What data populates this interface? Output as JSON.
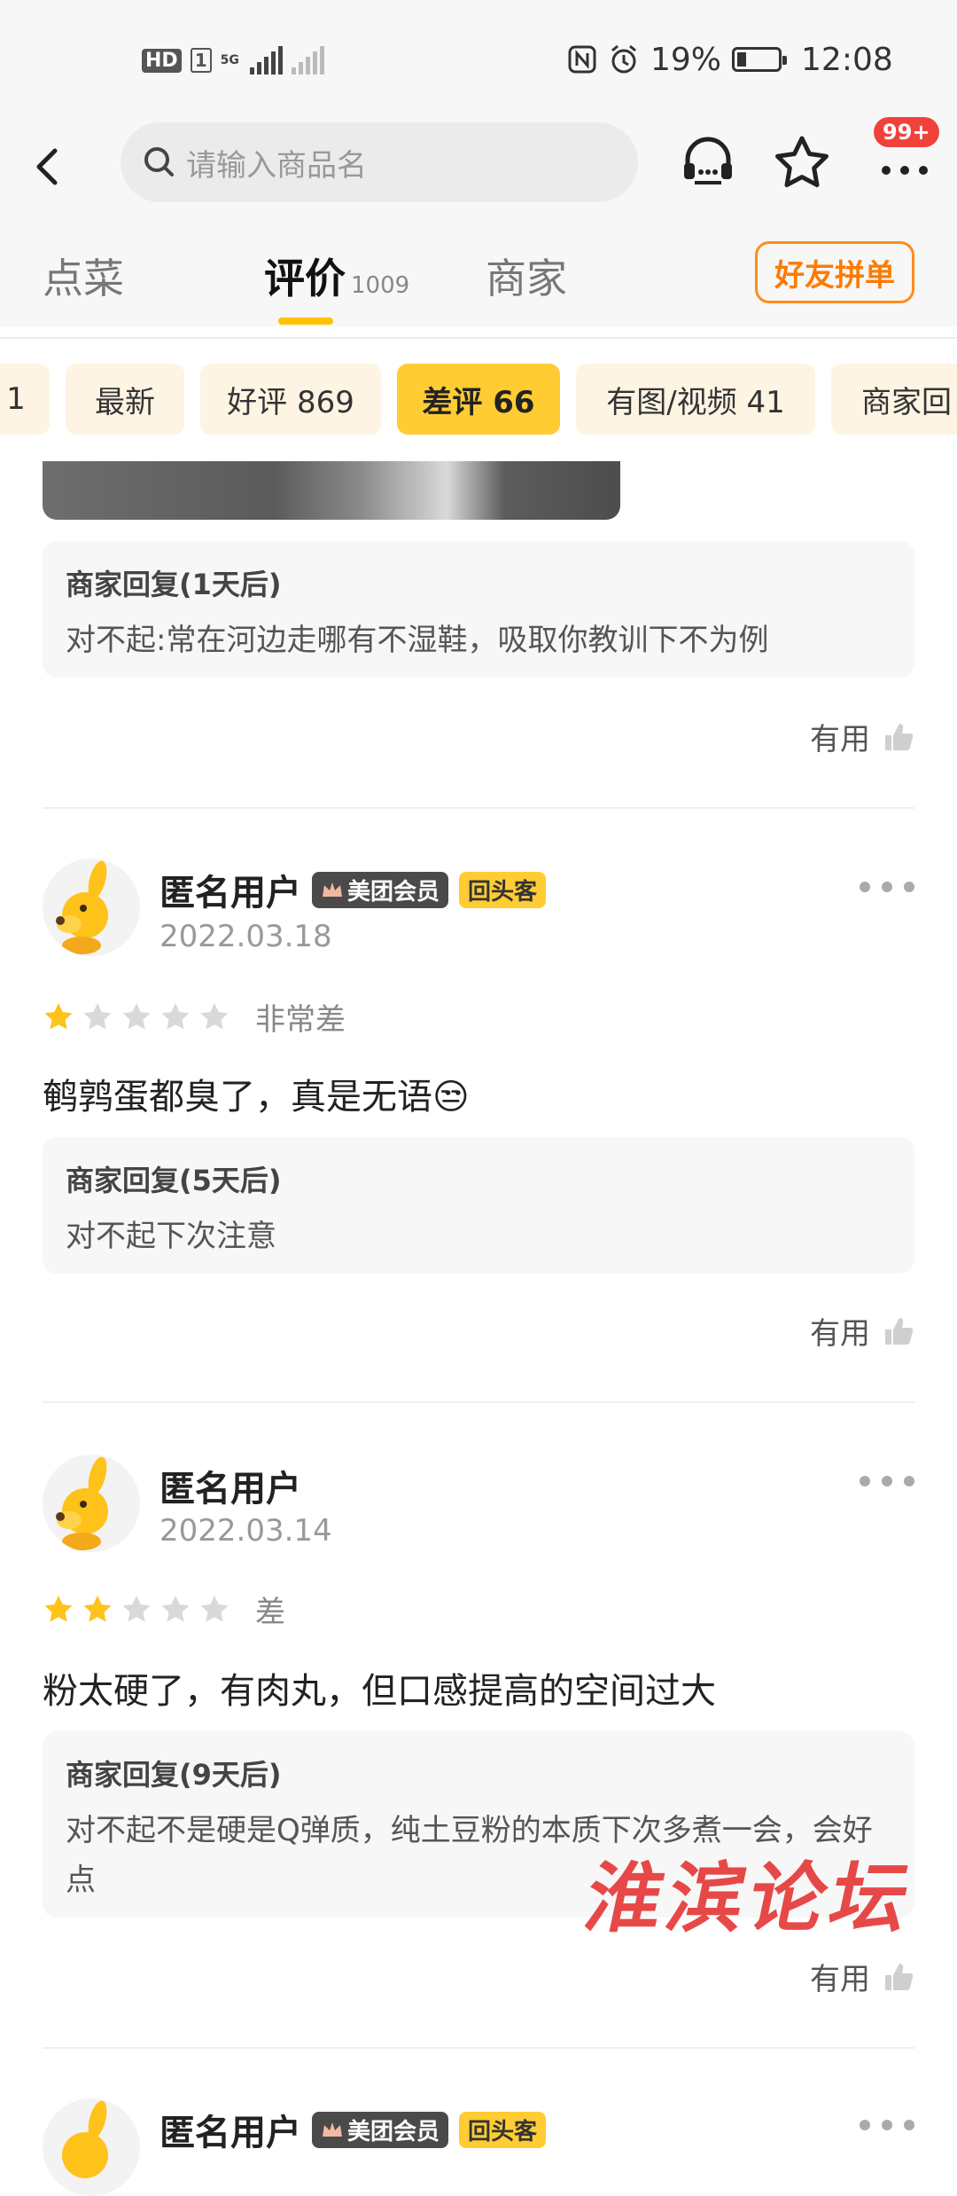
{
  "status_bar": {
    "hd": "HD",
    "sim1": "1",
    "net5g": "5G",
    "battery": "19%",
    "battery_level": 0.19,
    "time": "12:08"
  },
  "header": {
    "search_placeholder": "请输入商品名",
    "badge": "99+",
    "icons": [
      "back-icon",
      "customer-service-icon",
      "star-icon",
      "more-icon"
    ]
  },
  "tabs": [
    {
      "label": "点菜"
    },
    {
      "label": "评价",
      "count": "1009"
    },
    {
      "label": "商家"
    }
  ],
  "friend_order_button": "好友拼单",
  "filters": [
    {
      "label": "1"
    },
    {
      "label": "最新"
    },
    {
      "label": "好评 869"
    },
    {
      "label": "差评 66",
      "active": true
    },
    {
      "label": "有图/视频 41"
    },
    {
      "label": "商家回"
    }
  ],
  "reviews": [
    {
      "reply_title": "商家回复(1天后)",
      "reply_text": "对不起:常在河边走哪有不湿鞋，吸取你教训下不为例",
      "useful": "有用"
    },
    {
      "user": "匿名用户",
      "vip_badge": "美团会员",
      "repeat_badge": "回头客",
      "date": "2022.03.18",
      "stars": 1,
      "rating_text": "非常差",
      "text": "鹌鹑蛋都臭了，真是无语😒",
      "reply_title": "商家回复(5天后)",
      "reply_text": "对不起下次注意",
      "useful": "有用"
    },
    {
      "user": "匿名用户",
      "date": "2022.03.14",
      "stars": 2,
      "rating_text": "差",
      "text": "粉太硬了，有肉丸，但口感提高的空间过大",
      "reply_title": "商家回复(9天后)",
      "reply_text": "对不起不是硬是Q弹质，纯土豆粉的本质下次多煮一会，会好点",
      "useful": "有用"
    },
    {
      "user": "匿名用户",
      "vip_badge": "美团会员",
      "repeat_badge": "回头客"
    }
  ],
  "watermark": "淮滨论坛",
  "colors": {
    "accent": "#ffcc33",
    "star_on": "#ffc21a",
    "star_off": "#d9d9d9",
    "orange": "#ff7a00",
    "badge_red": "#f0413b"
  }
}
